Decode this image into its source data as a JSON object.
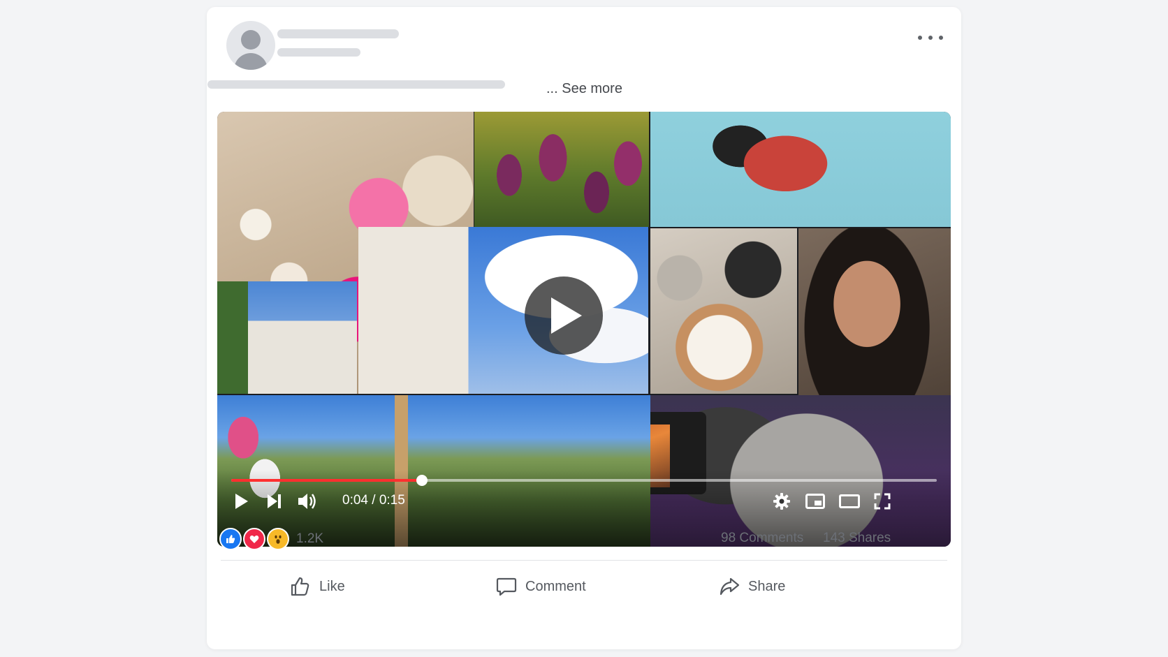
{
  "post": {
    "see_more": "... See more"
  },
  "video": {
    "time": "0:04 / 0:15",
    "progress_fraction": 0.27
  },
  "engagement": {
    "reactions_count": "1.2K",
    "comments": "98 Comments",
    "shares": "143 Shares"
  },
  "actions": {
    "like": "Like",
    "comment": "Comment",
    "share": "Share"
  },
  "icons": [
    "more-icon",
    "play-icon",
    "next-icon",
    "volume-icon",
    "settings-icon",
    "miniplayer-icon",
    "theater-icon",
    "fullscreen-icon",
    "like-reaction-icon",
    "love-reaction-icon",
    "wow-reaction-icon",
    "thumbs-up-icon",
    "comment-icon",
    "share-icon"
  ],
  "colors": {
    "progress": "#ff2f2f",
    "like": "#1877f2",
    "love": "#f0284a",
    "wow": "#f7b928"
  }
}
